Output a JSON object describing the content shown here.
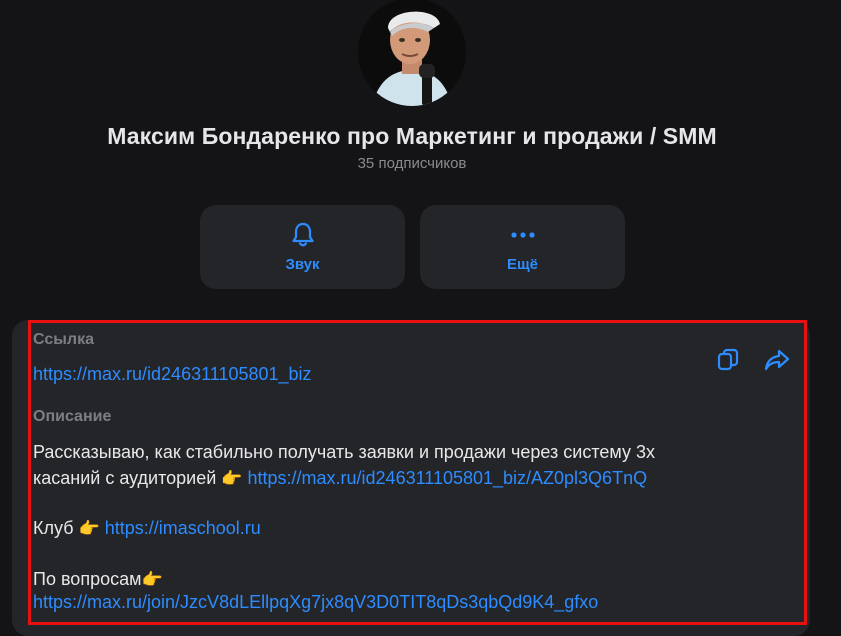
{
  "channel": {
    "title": "Максим Бондаренко про Маркетинг и продажи / SMM",
    "subscribers": "35 подписчиков"
  },
  "actions": [
    {
      "label": "Звук",
      "icon": "bell-icon"
    },
    {
      "label": "Ещё",
      "icon": "more-dots-icon"
    }
  ],
  "info": {
    "link_label": "Ссылка",
    "link_url": "https://max.ru/id246311105801_biz",
    "description_label": "Описание",
    "description": {
      "line1": "Рассказываю, как стабильно получать заявки и продажи через систему 3х",
      "line2_text": "касаний с аудиторией",
      "line2_link": "https://max.ru/id246311105801_biz/AZ0pl3Q6TnQ",
      "club_text": "Клуб",
      "club_link": "https://imaschool.ru",
      "questions_text": "По вопросам",
      "questions_link": "https://max.ru/join/JzcV8dLEllpqXg7jx8qV3D0TIT8qDs3qbQd9K4_gfxo",
      "emoji": "👉"
    },
    "copy_icon": "copy-icon",
    "share_icon": "share-icon"
  },
  "colors": {
    "accent": "#2d8cff",
    "background": "#141416",
    "card": "#242529",
    "highlight": "#e81010"
  }
}
